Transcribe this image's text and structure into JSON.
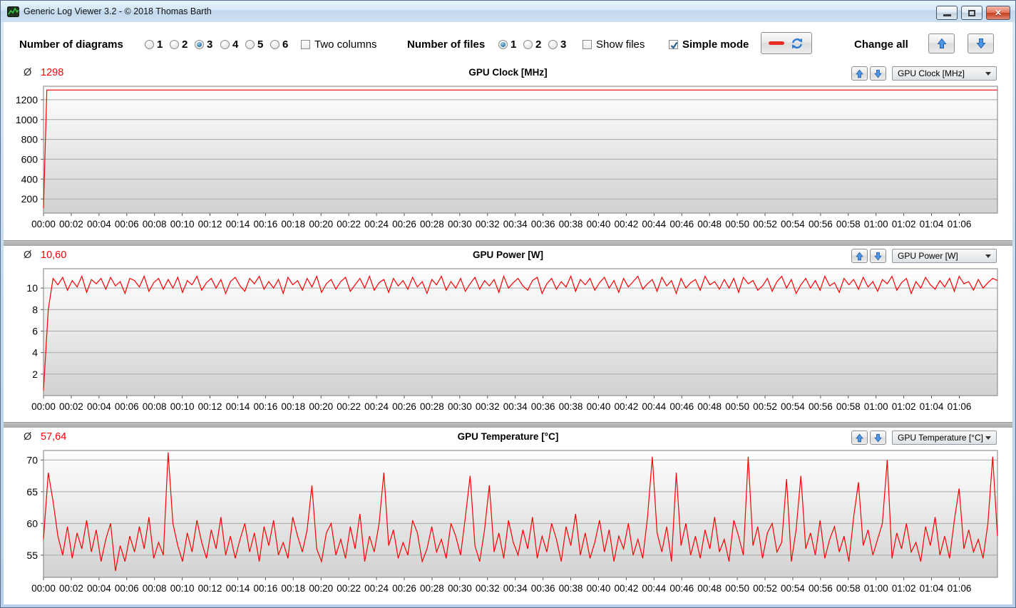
{
  "window": {
    "title": "Generic Log Viewer 3.2 - © 2018 Thomas Barth"
  },
  "toolbar": {
    "diagrams_label": "Number of diagrams",
    "diagram_options": [
      "1",
      "2",
      "3",
      "4",
      "5",
      "6"
    ],
    "diagrams_selected": "3",
    "two_columns_label": "Two columns",
    "files_label": "Number of files",
    "file_options": [
      "1",
      "2",
      "3"
    ],
    "files_selected": "1",
    "show_files_label": "Show files",
    "simple_mode_label": "Simple mode",
    "simple_mode_checked": true,
    "change_all_label": "Change all"
  },
  "colors": {
    "line": "#fb0000",
    "average_text": "#fb0000",
    "grid": "#a8a8a8",
    "plot_border": "#7e7e7e",
    "plot_bg_top": "#ffffff",
    "plot_bg_bottom": "#d2d2d2",
    "arrow_blue": "#4f96e8"
  },
  "x_labels": [
    "00:00",
    "00:02",
    "00:04",
    "00:06",
    "00:08",
    "00:10",
    "00:12",
    "00:14",
    "00:16",
    "00:18",
    "00:20",
    "00:22",
    "00:24",
    "00:26",
    "00:28",
    "00:30",
    "00:32",
    "00:34",
    "00:36",
    "00:38",
    "00:40",
    "00:42",
    "00:44",
    "00:46",
    "00:48",
    "00:50",
    "00:52",
    "00:54",
    "00:56",
    "00:58",
    "01:00",
    "01:02",
    "01:04",
    "01:06"
  ],
  "chart_data": [
    {
      "id": "gpu-clock",
      "type": "line",
      "title": "GPU Clock [MHz]",
      "average_symbol": "Ø",
      "average": "1298",
      "dropdown_value": "GPU Clock [MHz]",
      "ylim": [
        57,
        1336
      ],
      "y_ticks": [
        200,
        400,
        600,
        800,
        1000,
        1200
      ],
      "points": [
        [
          0,
          107
        ],
        [
          0.0035,
          1298
        ],
        [
          1,
          1298
        ]
      ]
    },
    {
      "id": "gpu-power",
      "type": "line",
      "title": "GPU Power [W]",
      "average_symbol": "Ø",
      "average": "10,60",
      "dropdown_value": "GPU Power [W]",
      "ylim": [
        0,
        11.8
      ],
      "y_ticks": [
        2,
        4,
        6,
        8,
        10
      ],
      "values": [
        0.5,
        8.0,
        10.9,
        10.3,
        11.0,
        9.8,
        10.7,
        10.1,
        11.1,
        9.6,
        10.8,
        10.4,
        10.9,
        9.9,
        11.0,
        10.2,
        10.6,
        9.5,
        10.9,
        10.7,
        10.1,
        11.1,
        9.7,
        10.5,
        10.9,
        9.9,
        10.8,
        10.0,
        11.0,
        9.6,
        10.7,
        10.3,
        11.1,
        9.8,
        10.5,
        10.9,
        10.0,
        10.8,
        9.5,
        10.6,
        11.0,
        10.2,
        9.7,
        10.9,
        10.4,
        11.1,
        9.9,
        10.6,
        10.0,
        10.8,
        9.5,
        11.0,
        10.3,
        10.7,
        9.8,
        10.9,
        10.1,
        11.1,
        9.6,
        10.4,
        10.8,
        9.9,
        10.6,
        11.0,
        9.7,
        10.3,
        10.9,
        10.0,
        11.1,
        9.8,
        10.5,
        10.8,
        9.6,
        10.9,
        10.2,
        10.7,
        9.9,
        11.0,
        10.1,
        10.6,
        9.5,
        10.8,
        10.3,
        11.1,
        9.8,
        10.6,
        10.0,
        10.9,
        9.7,
        10.4,
        11.0,
        9.9,
        10.7,
        10.2,
        10.8,
        9.6,
        11.1,
        10.0,
        10.5,
        10.9,
        10.2,
        9.8,
        10.7,
        11.0,
        9.5,
        10.4,
        10.9,
        9.9,
        10.6,
        10.1,
        11.1,
        9.7,
        10.8,
        10.3,
        10.9,
        9.8,
        10.5,
        11.0,
        10.0,
        10.7,
        9.6,
        10.9,
        10.1,
        10.6,
        11.1,
        9.9,
        10.4,
        10.8,
        9.7,
        11.0,
        10.2,
        10.7,
        9.5,
        10.9,
        10.0,
        10.5,
        10.8,
        9.8,
        11.1,
        10.3,
        10.6,
        9.9,
        10.8,
        10.0,
        10.9,
        9.6,
        11.0,
        10.4,
        10.7,
        9.8,
        10.2,
        10.9,
        9.7,
        10.6,
        11.1,
        10.0,
        10.8,
        9.5,
        10.3,
        10.9,
        10.0,
        10.7,
        9.8,
        11.1,
        10.2,
        10.5,
        9.6,
        10.9,
        10.3,
        10.8,
        9.9,
        11.0,
        10.1,
        10.6,
        9.7,
        10.8,
        10.4,
        11.1,
        9.8,
        10.5,
        10.9,
        9.5,
        10.6,
        10.0,
        11.0,
        10.3,
        9.9,
        10.7,
        10.1,
        10.9,
        9.7,
        11.1,
        10.4,
        10.6,
        9.8,
        10.8,
        10.0,
        10.5,
        10.9,
        10.7
      ]
    },
    {
      "id": "gpu-temp",
      "type": "line",
      "title": "GPU Temperature [°C]",
      "average_symbol": "Ø",
      "average": "57,64",
      "dropdown_value": "GPU Temperature [°C]",
      "ylim": [
        51.5,
        71.5
      ],
      "y_ticks": [
        55,
        60,
        65,
        70
      ],
      "values": [
        57.5,
        68.0,
        63.5,
        58.0,
        55.0,
        59.5,
        54.5,
        58.5,
        56.0,
        60.5,
        55.5,
        59.0,
        54.0,
        57.5,
        60.0,
        52.5,
        56.5,
        54.0,
        58.0,
        55.5,
        59.5,
        56.0,
        61.0,
        54.5,
        57.0,
        55.0,
        71.2,
        60.0,
        56.5,
        54.0,
        58.5,
        55.5,
        60.5,
        57.0,
        54.5,
        59.0,
        56.0,
        61.0,
        55.0,
        58.0,
        54.5,
        57.5,
        60.0,
        55.5,
        58.5,
        54.0,
        59.5,
        56.5,
        60.5,
        55.0,
        57.0,
        54.5,
        61.0,
        58.0,
        55.5,
        59.0,
        66.0,
        56.0,
        54.0,
        58.5,
        60.0,
        55.0,
        57.5,
        54.5,
        59.5,
        56.0,
        61.5,
        54.0,
        58.0,
        55.5,
        60.0,
        68.0,
        56.5,
        59.0,
        54.5,
        57.0,
        55.0,
        60.5,
        58.5,
        54.0,
        56.0,
        59.5,
        55.5,
        57.5,
        54.5,
        60.0,
        58.0,
        55.0,
        61.0,
        67.5,
        56.5,
        54.0,
        59.0,
        66.0,
        55.5,
        58.5,
        54.5,
        60.5,
        57.0,
        55.0,
        59.0,
        56.0,
        61.0,
        54.5,
        58.0,
        55.5,
        60.0,
        57.5,
        54.0,
        59.5,
        56.5,
        61.5,
        55.0,
        58.5,
        54.5,
        57.0,
        60.5,
        55.5,
        59.0,
        54.0,
        58.0,
        56.0,
        60.0,
        55.0,
        57.5,
        54.5,
        61.0,
        70.5,
        58.5,
        55.5,
        59.5,
        54.0,
        68.0,
        56.5,
        60.0,
        55.0,
        58.0,
        54.5,
        59.0,
        56.0,
        61.0,
        55.5,
        57.5,
        54.0,
        60.5,
        58.0,
        55.0,
        70.5,
        56.5,
        59.5,
        54.5,
        58.5,
        60.0,
        55.5,
        57.0,
        67.0,
        54.0,
        59.0,
        67.5,
        56.0,
        58.5,
        55.0,
        60.5,
        54.5,
        57.5,
        59.5,
        55.5,
        58.0,
        54.0,
        61.0,
        66.5,
        56.5,
        59.0,
        55.0,
        57.5,
        60.0,
        70.0,
        54.5,
        58.5,
        56.0,
        60.0,
        55.5,
        57.0,
        54.0,
        59.5,
        56.5,
        61.0,
        55.0,
        58.0,
        54.5,
        60.5,
        65.5,
        56.0,
        59.0,
        55.5,
        57.5,
        54.5,
        60.0,
        70.5,
        58.0
      ]
    }
  ]
}
